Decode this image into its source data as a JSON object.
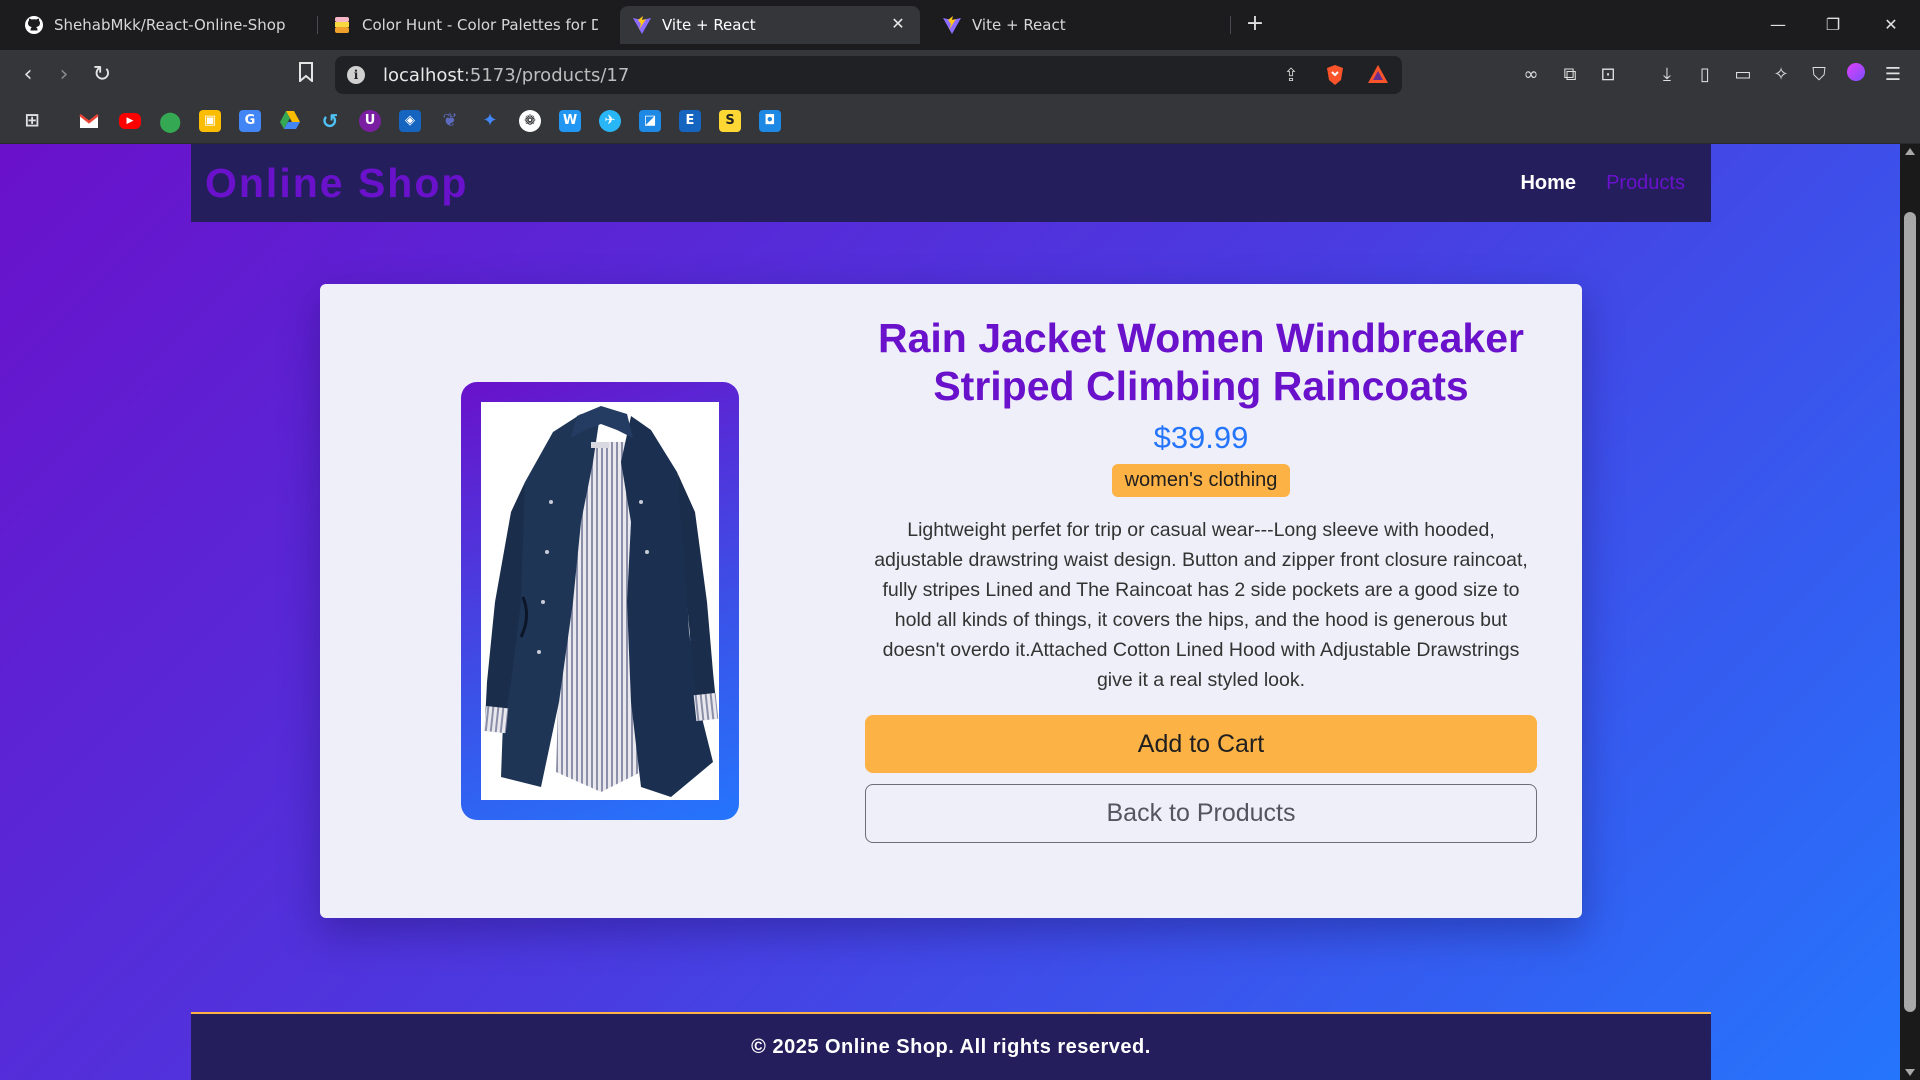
{
  "browser": {
    "tabs": [
      {
        "label": "ShehabMkk/React-Online-Shop",
        "icon": "github-icon"
      },
      {
        "label": "Color Hunt - Color Palettes for Design",
        "icon": "colorhunt-icon"
      },
      {
        "label": "Vite + React",
        "icon": "vite-icon",
        "active": true
      },
      {
        "label": "Vite + React",
        "icon": "vite-icon"
      }
    ],
    "url_host": "localhost",
    "url_path": ":5173/products/17",
    "bookmark_icons": [
      "gmail-icon",
      "youtube-icon",
      "maps-icon",
      "classroom-icon",
      "translate-icon",
      "drive-icon",
      "app-icon",
      "udemy-icon",
      "app-icon",
      "app-icon",
      "gemini-icon",
      "chatgpt-icon",
      "wordpress-icon",
      "app-icon",
      "app-icon",
      "e-icon",
      "s-icon",
      "app-icon"
    ]
  },
  "site": {
    "logo": "Online Shop",
    "nav": {
      "home": "Home",
      "products": "Products"
    }
  },
  "product": {
    "title": "Rain Jacket Women Windbreaker Striped Climbing Raincoats",
    "price": "$39.99",
    "category": "women's clothing",
    "description": "Lightweight perfet for trip or casual wear---Long sleeve with hooded, adjustable drawstring waist design. Button and zipper front closure raincoat, fully stripes Lined and The Raincoat has 2 side pockets are a good size to hold all kinds of things, it covers the hips, and the hood is generous but doesn't overdo it.Attached Cotton Lined Hood with Adjustable Drawstrings give it a real styled look.",
    "add_to_cart": "Add to Cart",
    "back": "Back to Products"
  },
  "footer": {
    "text": "© 2025 Online Shop. All rights reserved."
  },
  "colors": {
    "primary": "#6a11cb",
    "secondary": "#2575fc",
    "accent": "#fdb245",
    "header_bg": "#241f5c",
    "card_bg": "#eeeff8"
  }
}
